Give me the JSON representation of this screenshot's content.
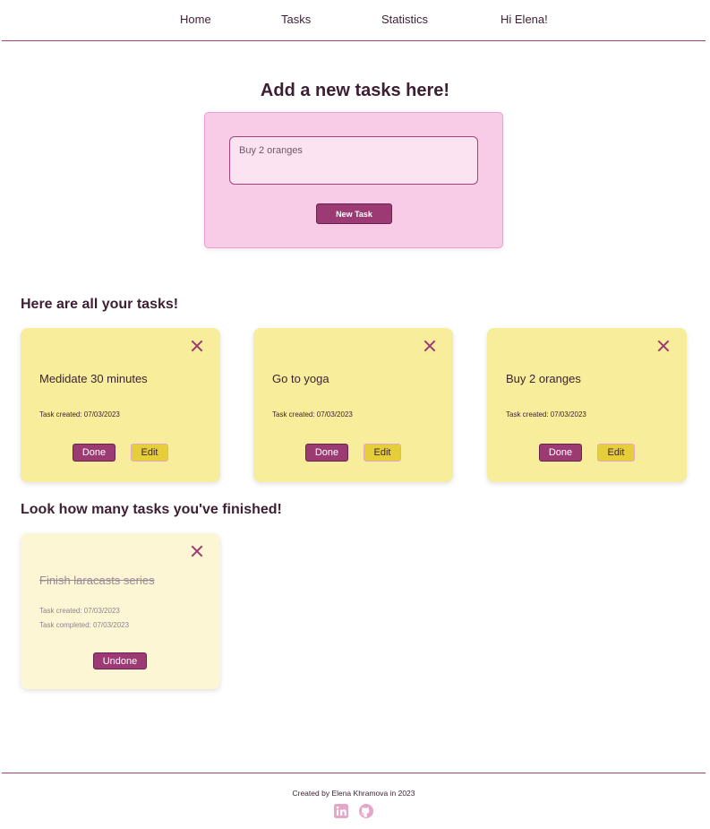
{
  "nav": {
    "home": "Home",
    "tasks": "Tasks",
    "statistics": "Statistics",
    "greeting": "Hi Elena!"
  },
  "add_task": {
    "title": "Add a new tasks here!",
    "input_value": "Buy 2 oranges",
    "button_label": "New Task"
  },
  "tasks_section": {
    "title": "Here are all your tasks!",
    "tasks": [
      {
        "title": "Medidate 30 minutes",
        "created": "Task created: 07/03/2023",
        "done_label": "Done",
        "edit_label": "Edit"
      },
      {
        "title": "Go to yoga",
        "created": "Task created: 07/03/2023",
        "done_label": "Done",
        "edit_label": "Edit"
      },
      {
        "title": "Buy 2 oranges",
        "created": "Task created: 07/03/2023",
        "done_label": "Done",
        "edit_label": "Edit"
      }
    ]
  },
  "finished_section": {
    "title": "Look how many tasks you've finished!",
    "tasks": [
      {
        "title": "Finish laracasts series",
        "created": "Task created: 07/03/2023",
        "completed": "Task completed: 07/03/2023",
        "undone_label": "Undone"
      }
    ]
  },
  "footer": {
    "credit": "Created by Elena Khramova in 2023",
    "icons": [
      "linkedin-icon",
      "github-icon"
    ]
  },
  "colors": {
    "accent": "#9b3a73",
    "add_box": "#f8cbe6",
    "task_card": "#f7ed9b",
    "done_card": "#fcf6d4",
    "edit_button": "#e4cf3b"
  }
}
